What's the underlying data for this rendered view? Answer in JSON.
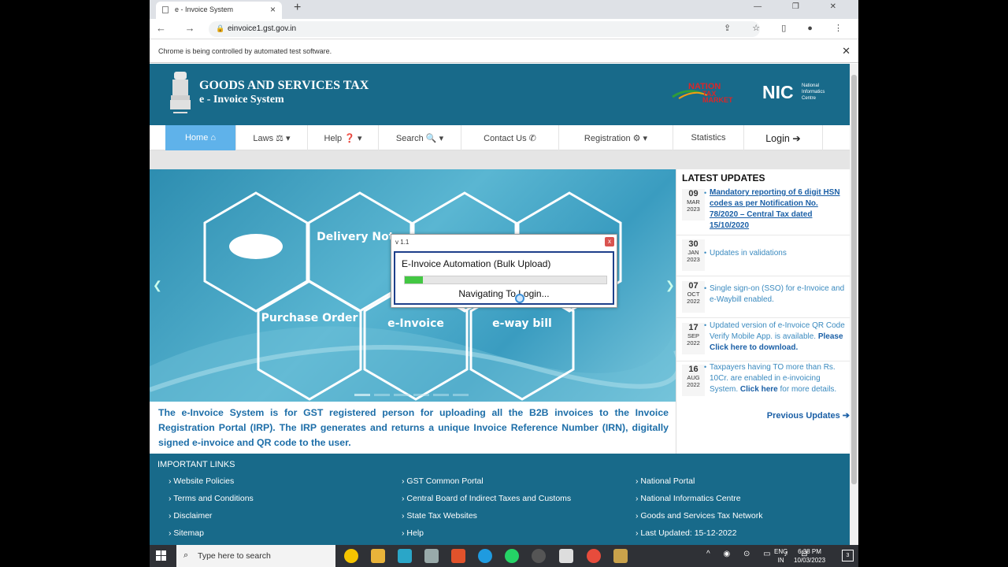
{
  "browser": {
    "tab_title": "e - Invoice System",
    "new_tab": "+",
    "url": "einvoice1.gst.gov.in",
    "infobar_text": "Chrome is being controlled by automated test software."
  },
  "header": {
    "title_line1": "GOODS AND SERVICES TAX",
    "title_line2": "e - Invoice System",
    "emblem_caption": "सत्यमेव जयते",
    "logo1": "NATION TAX MARKET",
    "logo2_abbr": "NIC",
    "logo2_text": "National Informatics Centre"
  },
  "menu": [
    {
      "label": "Home ⌂",
      "w": 90
    },
    {
      "label": "Laws ⚖ ▾",
      "w": 91
    },
    {
      "label": "Help ❓ ▾",
      "w": 90
    },
    {
      "label": "Search 🔍 ▾",
      "w": 105
    },
    {
      "label": "Contact Us ✆",
      "w": 124
    },
    {
      "label": "Registration ⚙ ▾",
      "w": 145
    },
    {
      "label": "Statistics",
      "w": 90
    },
    {
      "label": "Login ➔",
      "w": 100
    }
  ],
  "slider": {
    "labels": [
      "Delivery Note",
      "Purchase Order",
      "e-Invoice",
      "e-way bill"
    ]
  },
  "intro_text": "The e-Invoice System is for GST registered person for uploading all the B2B invoices to the Invoice Registration Portal (IRP). The IRP generates and returns a unique Invoice Reference Number (IRN), digitally signed e-invoice and QR code to the user.",
  "updates": {
    "title": "LATEST UPDATES",
    "items": [
      {
        "day": "09",
        "month": "MAR",
        "year": "2023",
        "text": "Mandatory reporting of 6 digit HSN codes as per Notification No. 78/2020 – Central Tax dated 15/10/2020"
      },
      {
        "day": "30",
        "month": "JAN",
        "year": "2023",
        "text": "Updates in validations"
      },
      {
        "day": "07",
        "month": "OCT",
        "year": "2022",
        "text": "Single sign-on (SSO) for e-Invoice and e-Waybill enabled."
      },
      {
        "day": "17",
        "month": "SEP",
        "year": "2022",
        "text": "Updated version of e-Invoice QR Code Verify Mobile App. is available.",
        "link": "Please Click here to download."
      },
      {
        "day": "16",
        "month": "AUG",
        "year": "2022",
        "text": "Taxpayers having TO more than Rs. 10Cr. are enabled in e-invoicing System.",
        "link": "Click here",
        "suffix": " for more details."
      }
    ],
    "previous": "Previous Updates ➔"
  },
  "footer": {
    "title": "IMPORTANT LINKS",
    "col1": [
      "Website Policies",
      "Terms and Conditions",
      "Disclaimer",
      "Sitemap"
    ],
    "col2": [
      "GST Common Portal",
      "Central Board of Indirect Taxes and Customs",
      "State Tax Websites",
      "Help"
    ],
    "col3": [
      "National Portal",
      "National Informatics Centre",
      "Goods and Services Tax Network",
      "Last Updated: 15-12-2022"
    ]
  },
  "modal": {
    "version": "v 1.1",
    "close": "x",
    "title": "E-Invoice Automation (Bulk Upload)",
    "status": "Navigating To Login...",
    "progress": 0.09
  },
  "taskbar": {
    "search_placeholder": "Type here to search",
    "lang1": "ENG",
    "lang2": "IN",
    "time": "6:38 PM",
    "date": "10/03/2023",
    "notif_count": "3"
  }
}
